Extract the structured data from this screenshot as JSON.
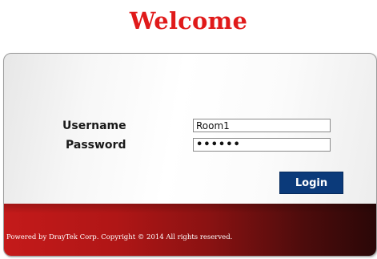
{
  "heading": "Welcome",
  "form": {
    "username_label": "Username",
    "password_label": "Password",
    "username_value": "Room1",
    "password_value": "••••••",
    "login_label": "Login"
  },
  "footer": {
    "copyright": "Powered by DrayTek Corp. Copyright © 2014 All rights reserved."
  },
  "colors": {
    "heading": "#e01a1a",
    "login_button": "#0b3a7a",
    "footer_band": "#b01616"
  }
}
